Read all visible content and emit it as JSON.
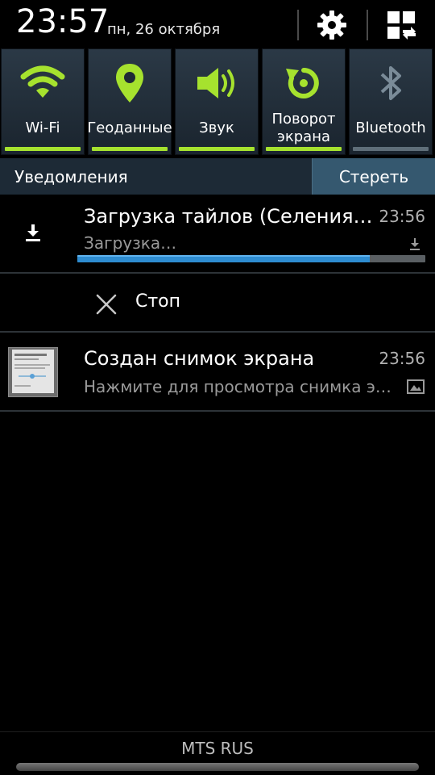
{
  "status": {
    "time": "23:57",
    "date": "пн, 26 октября"
  },
  "toggles": [
    {
      "label": "Wi-Fi",
      "icon": "wifi-icon",
      "active": true
    },
    {
      "label": "Геоданные",
      "icon": "location-pin-icon",
      "active": true
    },
    {
      "label": "Звук",
      "icon": "volume-icon",
      "active": true
    },
    {
      "label": "Поворот экрана",
      "icon": "rotate-icon",
      "active": true
    },
    {
      "label": "Bluetooth",
      "icon": "bluetooth-icon",
      "active": false
    }
  ],
  "colors": {
    "active": "#a6e22e",
    "inactive": "#7a8b98",
    "progress": "#2e8cd0"
  },
  "notifications_header": {
    "title": "Уведомления",
    "clear_label": "Стереть"
  },
  "notifications": [
    {
      "title": "Загрузка тайлов (Селения…",
      "text": "Загрузка…",
      "time": "23:56",
      "progress": 0.84,
      "action_label": "Стоп"
    },
    {
      "title": "Создан снимок экрана",
      "text": "Нажмите для просмотра снимка э…",
      "time": "23:56"
    }
  ],
  "footer": {
    "carrier": "MTS RUS"
  }
}
